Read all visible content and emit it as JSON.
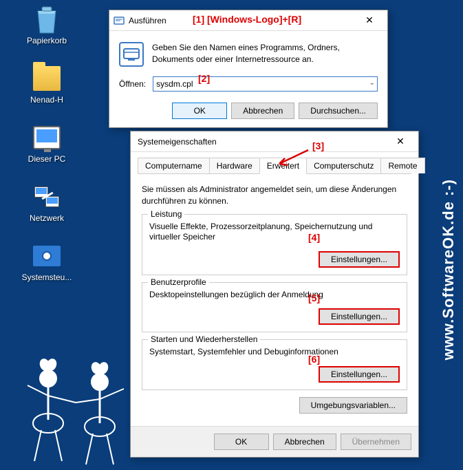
{
  "desktop": {
    "recycle": "Papierkorb",
    "folder": "Nenad-H",
    "pc": "Dieser PC",
    "network": "Netzwerk",
    "control_panel": "Systemsteu..."
  },
  "run_dialog": {
    "title": "Ausführen",
    "description": "Geben Sie den Namen eines Programms, Ordners, Dokuments oder einer Internetressource an.",
    "open_label": "Öffnen:",
    "open_value": "sysdm.cpl",
    "ok": "OK",
    "cancel": "Abbrechen",
    "browse": "Durchsuchen..."
  },
  "sys_dialog": {
    "title": "Systemeigenschaften",
    "tabs": {
      "computername": "Computername",
      "hardware": "Hardware",
      "advanced": "Erweitert",
      "protection": "Computerschutz",
      "remote": "Remote"
    },
    "admin_note": "Sie müssen als Administrator angemeldet sein, um diese Änderungen durchführen zu können.",
    "perf": {
      "legend": "Leistung",
      "desc": "Visuelle Effekte, Prozessorzeitplanung, Speichernutzung und virtueller Speicher",
      "btn": "Einstellungen..."
    },
    "profiles": {
      "legend": "Benutzerprofile",
      "desc": "Desktopeinstellungen bezüglich der Anmeldung",
      "btn": "Einstellungen..."
    },
    "startup": {
      "legend": "Starten und Wiederherstellen",
      "desc": "Systemstart, Systemfehler und Debuginformationen",
      "btn": "Einstellungen..."
    },
    "envvars": "Umgebungsvariablen...",
    "ok": "OK",
    "cancel": "Abbrechen",
    "apply": "Übernehmen"
  },
  "annotations": {
    "a1": "[1]  [Windows-Logo]+[R]",
    "a2": "[2]",
    "a3": "[3]",
    "a4": "[4]",
    "a5": "[5]",
    "a6": "[6]"
  },
  "watermark": "www.SoftwareOK.de :-)"
}
